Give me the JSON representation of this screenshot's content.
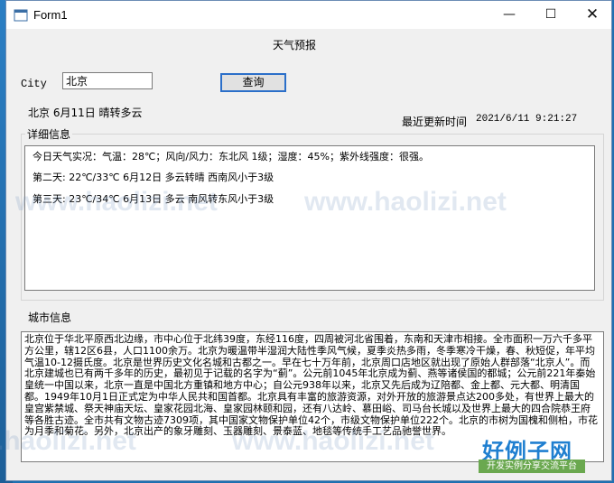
{
  "window": {
    "title": "Form1",
    "minimize_glyph": "—",
    "maximize_glyph": "☐",
    "close_glyph": "✕"
  },
  "form": {
    "heading": "天气预报",
    "city_label": "City",
    "city_value": "北京",
    "query_button": "查询",
    "summary": "北京 6月11日 晴转多云",
    "updated_label": "最近更新时间",
    "updated_value": "2021/6/11 9:21:27"
  },
  "details": {
    "group_title": "详细信息",
    "lines": [
      "今日天气实况：气温：28℃；风向/风力：东北风 1级；湿度：45%；紫外线强度：很强。",
      "第二天:  22℃/33℃  6月12日 多云转晴  西南风小于3级",
      "第三天:  23℃/34℃  6月13日 多云  南风转东风小于3级"
    ]
  },
  "city_info": {
    "group_title": "城市信息",
    "text": "北京位于华北平原西北边缘，市中心位于北纬39度，东经116度，四周被河北省围着，东南和天津市相接。全市面积一万六千多平方公里，辖12区6县，人口1100余万。北京为暖温带半湿润大陆性季风气候，夏季炎热多雨，冬季寒冷干燥，春、秋短促，年平均气温10-12摄氏度。北京是世界历史文化名城和古都之一。早在七十万年前，北京周口店地区就出现了原始人群部落“北京人”。而北京建城也已有两千多年的历史，最初见于记载的名字为“蓟”。公元前1045年北京成为蓟、燕等诸侯国的都城；公元前221年秦始皇统一中国以来，北京一直是中国北方重镇和地方中心；自公元938年以来，北京又先后成为辽陪都、金上都、元大都、明清国都。1949年10月1日正式定为中华人民共和国首都。北京具有丰富的旅游资源，对外开放的旅游景点达200多处，有世界上最大的皇宫紫禁城、祭天神庙天坛、皇家花园北海、皇家园林颐和园，还有八达岭、慕田峪、司马台长城以及世界上最大的四合院恭王府等各胜古迹。全市共有文物古迹7309项，其中国家文物保护单位42个，市级文物保护单位222个。北京的市树为国槐和侧柏，市花为月季和菊花。另外，北京出产的象牙雕刻、玉器雕刻、景泰蓝、地毯等传统手工艺品驰誉世界。"
  },
  "watermark": {
    "text": "www.haolizi.net"
  },
  "logo": {
    "title": "好例子网",
    "subtitle": "开发实例分享交流平台"
  },
  "colors": {
    "accent": "#2b6fc9",
    "watermark": "#b8c8dc",
    "logo_blue": "#1f7fd0",
    "logo_green": "#6aa84f"
  }
}
